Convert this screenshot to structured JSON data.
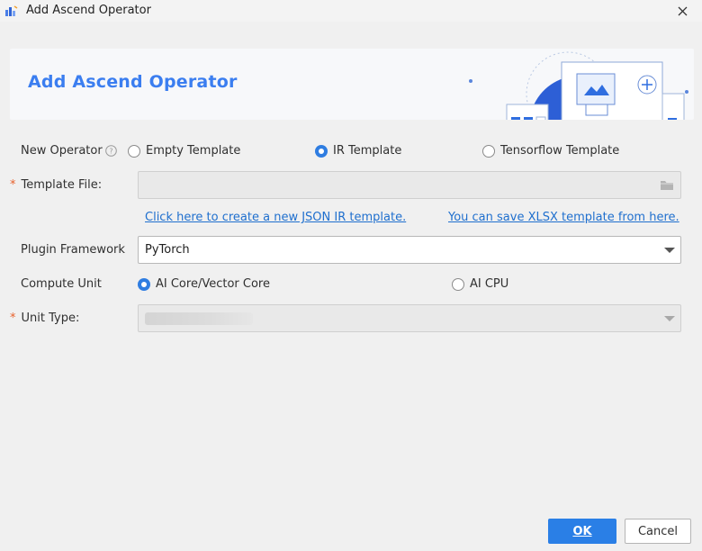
{
  "window": {
    "title": "Add Ascend Operator",
    "app_icon": "ascend-logo-icon",
    "close_icon": "close-icon"
  },
  "banner": {
    "title": "Add Ascend Operator",
    "accent_color": "#3b7ef0"
  },
  "form": {
    "new_operator": {
      "label": "New Operator",
      "help_icon": "help-circle-icon",
      "options": [
        "Empty Template",
        "IR Template",
        "Tensorflow Template"
      ],
      "selected": "IR Template"
    },
    "template_file": {
      "required_mark": "*",
      "label": "Template File:",
      "value": "",
      "browse_icon": "folder-icon"
    },
    "links": {
      "create_json": "Click here to create a new JSON IR template.",
      "save_xlsx": "You can save XLSX template from here."
    },
    "plugin_framework": {
      "label": "Plugin Framework",
      "value": "PyTorch"
    },
    "compute_unit": {
      "label": "Compute Unit",
      "options": [
        "AI Core/Vector Core",
        "AI CPU"
      ],
      "selected": "AI Core/Vector Core"
    },
    "unit_type": {
      "required_mark": "*",
      "label": "Unit Type:"
    }
  },
  "buttons": {
    "ok": "OK",
    "cancel": "Cancel"
  },
  "colors": {
    "primary": "#2a7fe6",
    "link": "#1f6fce",
    "required": "#e8612c"
  }
}
